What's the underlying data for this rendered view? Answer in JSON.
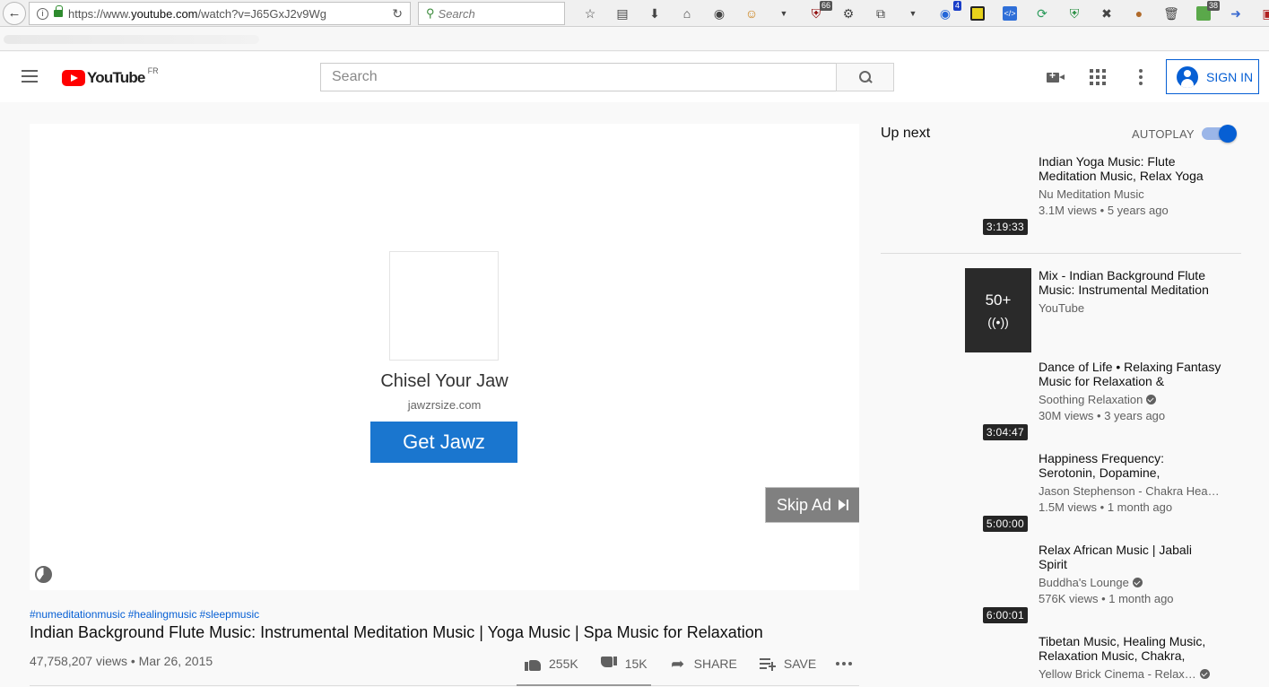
{
  "browser": {
    "url_prefix": "https://www.",
    "url_host": "youtube.com",
    "url_path": "/watch?v=J65GxJ2v9Wg",
    "search_placeholder": "Search",
    "badges": {
      "ublock": "66",
      "ext_blue": "4",
      "ext_green": "38"
    }
  },
  "youtube": {
    "logo_text": "YouTube",
    "country_code": "FR",
    "search_placeholder": "Search",
    "signin_label": "SIGN IN"
  },
  "ad": {
    "title": "Chisel Your Jaw",
    "domain": "jawzrsize.com",
    "cta": "Get Jawz",
    "skip_label": "Skip Ad"
  },
  "video": {
    "hashtags": [
      "#numeditationmusic",
      "#healingmusic",
      "#sleepmusic"
    ],
    "title": "Indian Background Flute Music: Instrumental Meditation Music | Yoga Music | Spa Music for Relaxation",
    "views": "47,758,207 views",
    "date": "Mar 26, 2015",
    "likes": "255K",
    "dislikes": "15K",
    "share_label": "SHARE",
    "save_label": "SAVE"
  },
  "sidebar": {
    "up_next_label": "Up next",
    "autoplay_label": "AUTOPLAY",
    "autoplay_on": true,
    "items": [
      {
        "title": "Indian Yoga Music: Flute Meditation Music, Relax Yoga",
        "channel": "Nu Meditation Music",
        "verified": false,
        "views": "3.1M views",
        "age": "5 years ago",
        "duration": "3:19:33"
      },
      {
        "title": "Mix - Indian Background Flute Music: Instrumental Meditation",
        "channel": "YouTube",
        "verified": false,
        "mix": true,
        "mix_count": "50+",
        "mix_icon": "((•))"
      },
      {
        "title": "Dance of Life • Relaxing Fantasy Music for Relaxation &",
        "channel": "Soothing Relaxation",
        "verified": true,
        "views": "30M views",
        "age": "3 years ago",
        "duration": "3:04:47"
      },
      {
        "title": "Happiness Frequency: Serotonin, Dopamine,",
        "channel": "Jason Stephenson - Chakra Hea…",
        "verified": false,
        "views": "1.5M views",
        "age": "1 month ago",
        "duration": "5:00:00"
      },
      {
        "title": "Relax African Music | Jabali Spirit",
        "channel": "Buddha's Lounge",
        "verified": true,
        "views": "576K views",
        "age": "1 month ago",
        "duration": "6:00:01"
      },
      {
        "title": "Tibetan Music, Healing Music, Relaxation Music, Chakra,",
        "channel": "Yellow Brick Cinema - Relax…",
        "verified": true
      }
    ]
  },
  "colors": {
    "accent_blue": "#065fd4",
    "cta_blue": "#1a76cf",
    "youtube_red": "#ff0000"
  }
}
